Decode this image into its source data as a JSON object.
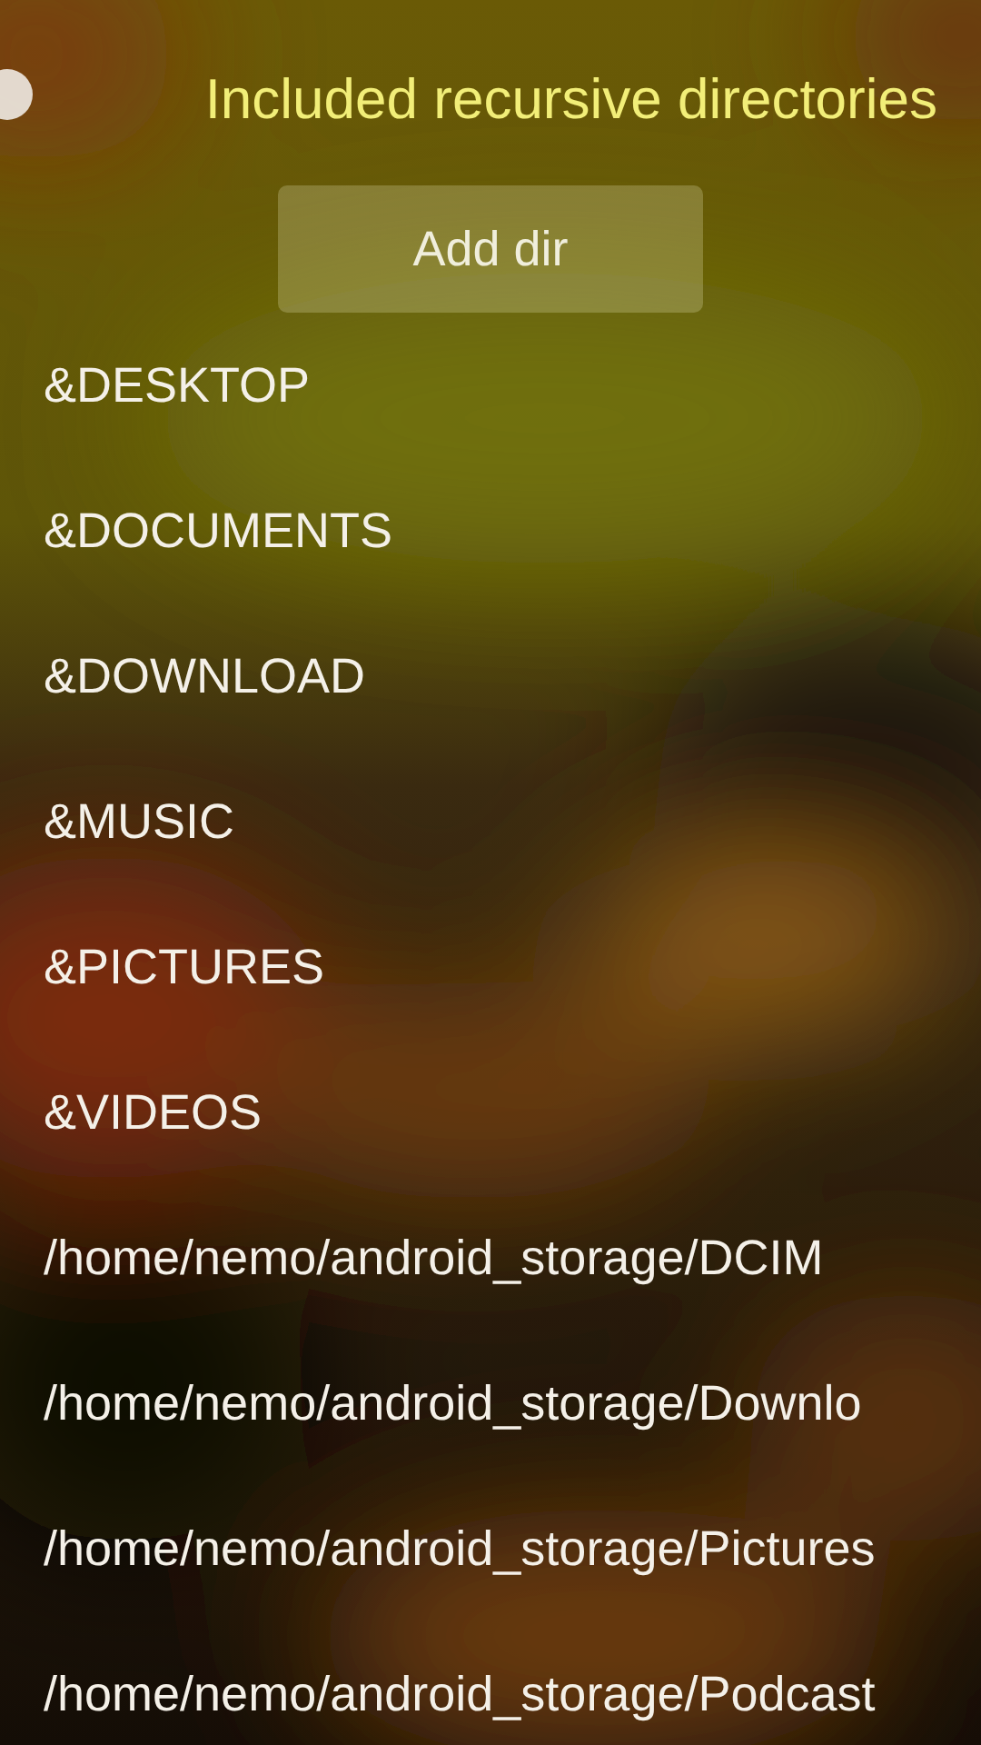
{
  "page": {
    "title": "Included recursive directories"
  },
  "add_button": {
    "label": "Add dir"
  },
  "directories": [
    {
      "path": "&DESKTOP"
    },
    {
      "path": "&DOCUMENTS"
    },
    {
      "path": "&DOWNLOAD"
    },
    {
      "path": "&MUSIC"
    },
    {
      "path": "&PICTURES"
    },
    {
      "path": "&VIDEOS"
    },
    {
      "path": "/home/nemo/android_storage/DCIM"
    },
    {
      "path": "/home/nemo/android_storage/Downlo"
    },
    {
      "path": "/home/nemo/android_storage/Pictures"
    },
    {
      "path": "/home/nemo/android_storage/Podcast"
    }
  ]
}
